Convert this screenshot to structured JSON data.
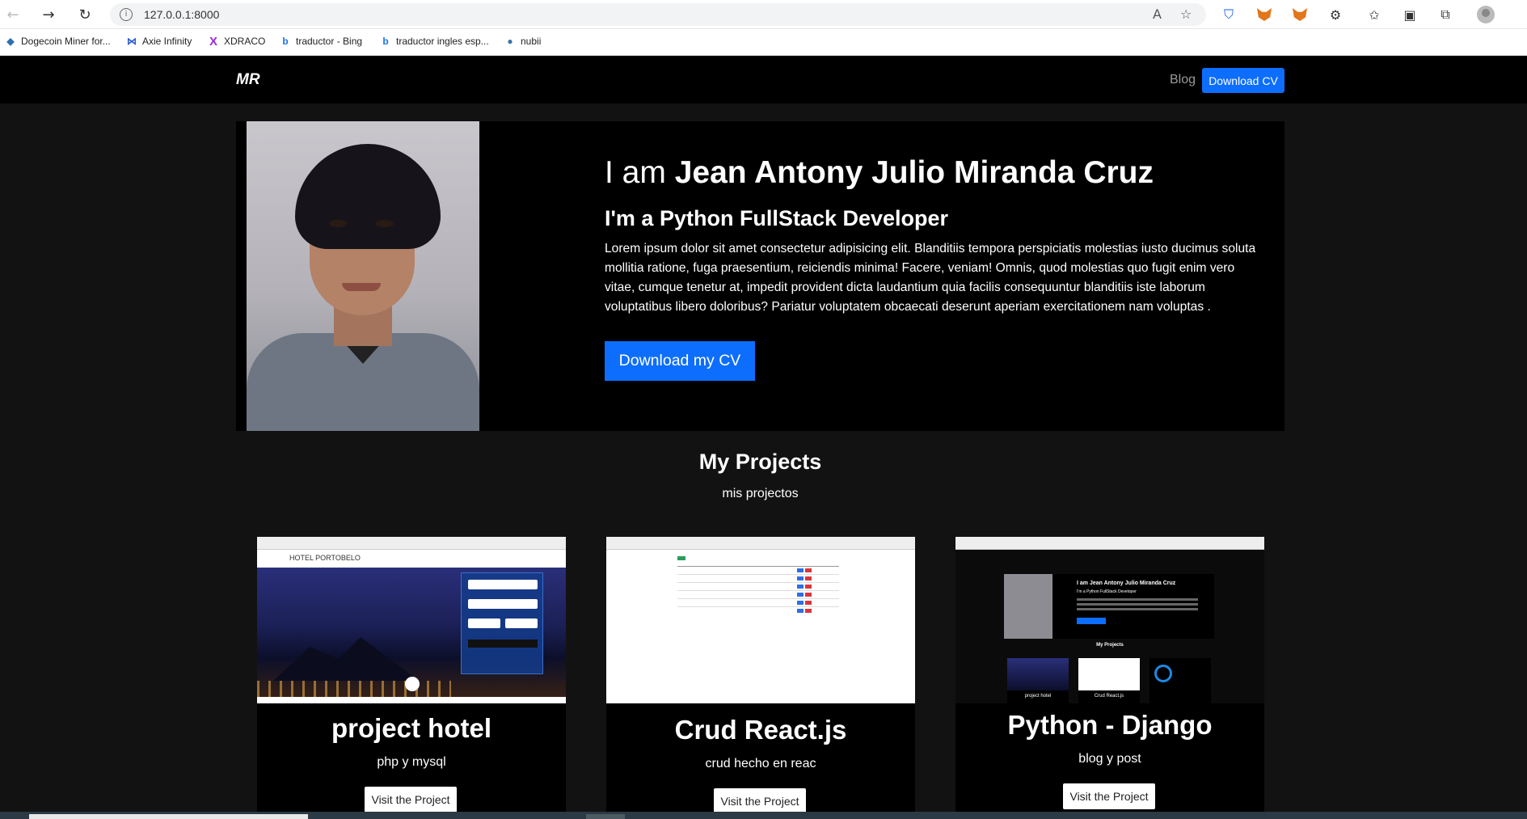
{
  "browser": {
    "url": "127.0.0.1:8000",
    "icons": [
      "back-icon",
      "forward-icon",
      "reload-icon",
      "info-icon",
      "read-aloud-icon",
      "favorite-star-icon",
      "bitwarden-icon",
      "metamask-icon",
      "metamask-icon",
      "extensions-icon",
      "favorites-icon",
      "collections-icon",
      "profile-icon"
    ],
    "bookmarks": [
      {
        "label": "Dogecoin Miner for...",
        "icon": "cube-icon"
      },
      {
        "label": "Axie Infinity",
        "icon": "axie-icon"
      },
      {
        "label": "XDRACO",
        "icon": "x-icon"
      },
      {
        "label": "traductor - Bing",
        "icon": "bing-icon"
      },
      {
        "label": "traductor ingles esp...",
        "icon": "bing-icon"
      },
      {
        "label": "nubii",
        "icon": "python-icon"
      }
    ]
  },
  "navbar": {
    "brand": "MR",
    "blog_label": "Blog",
    "cv_label": "Download CV",
    "cv_color": "#0d6efd"
  },
  "hero": {
    "title_prefix": "I am ",
    "title_name": "Jean Antony Julio Miranda Cruz",
    "subtitle": "I'm a Python FullStack Developer",
    "text": "Lorem ipsum dolor sit amet consectetur adipisicing elit. Blanditiis tempora perspiciatis molestias iusto ducimus soluta mollitia ratione, fuga praesentium, reiciendis minima! Facere, veniam! Omnis, quod molestias quo fugit enim vero vitae, cumque tenetur at, impedit provident dicta laudantium quia facilis consequuntur blanditiis iste laborum voluptatibus libero doloribus? Pariatur voluptatem obcaecati deserunt aperiam exercitationem nam voluptas .",
    "button_label": "Download my CV"
  },
  "projects": {
    "title": "My Projects",
    "subtitle": "mis projectos",
    "cards": [
      {
        "title": "project hotel",
        "desc": "php y mysql",
        "button": "Visit the Project",
        "thumb_label": "HOTEL PORTOBELO"
      },
      {
        "title": "Crud React.js",
        "desc": "crud hecho en reac",
        "button": "Visit the Project"
      },
      {
        "title": "Python - Django",
        "desc": "blog y post",
        "button": "Visit the Project",
        "thumb_title": "I am Jean Antony Julio Miranda Cruz",
        "thumb_sub": "I'm a Python FullStack Developer",
        "thumb_section": "My Projects",
        "thumb_cards": [
          "project hotel",
          "Crud React.js"
        ]
      }
    ]
  }
}
